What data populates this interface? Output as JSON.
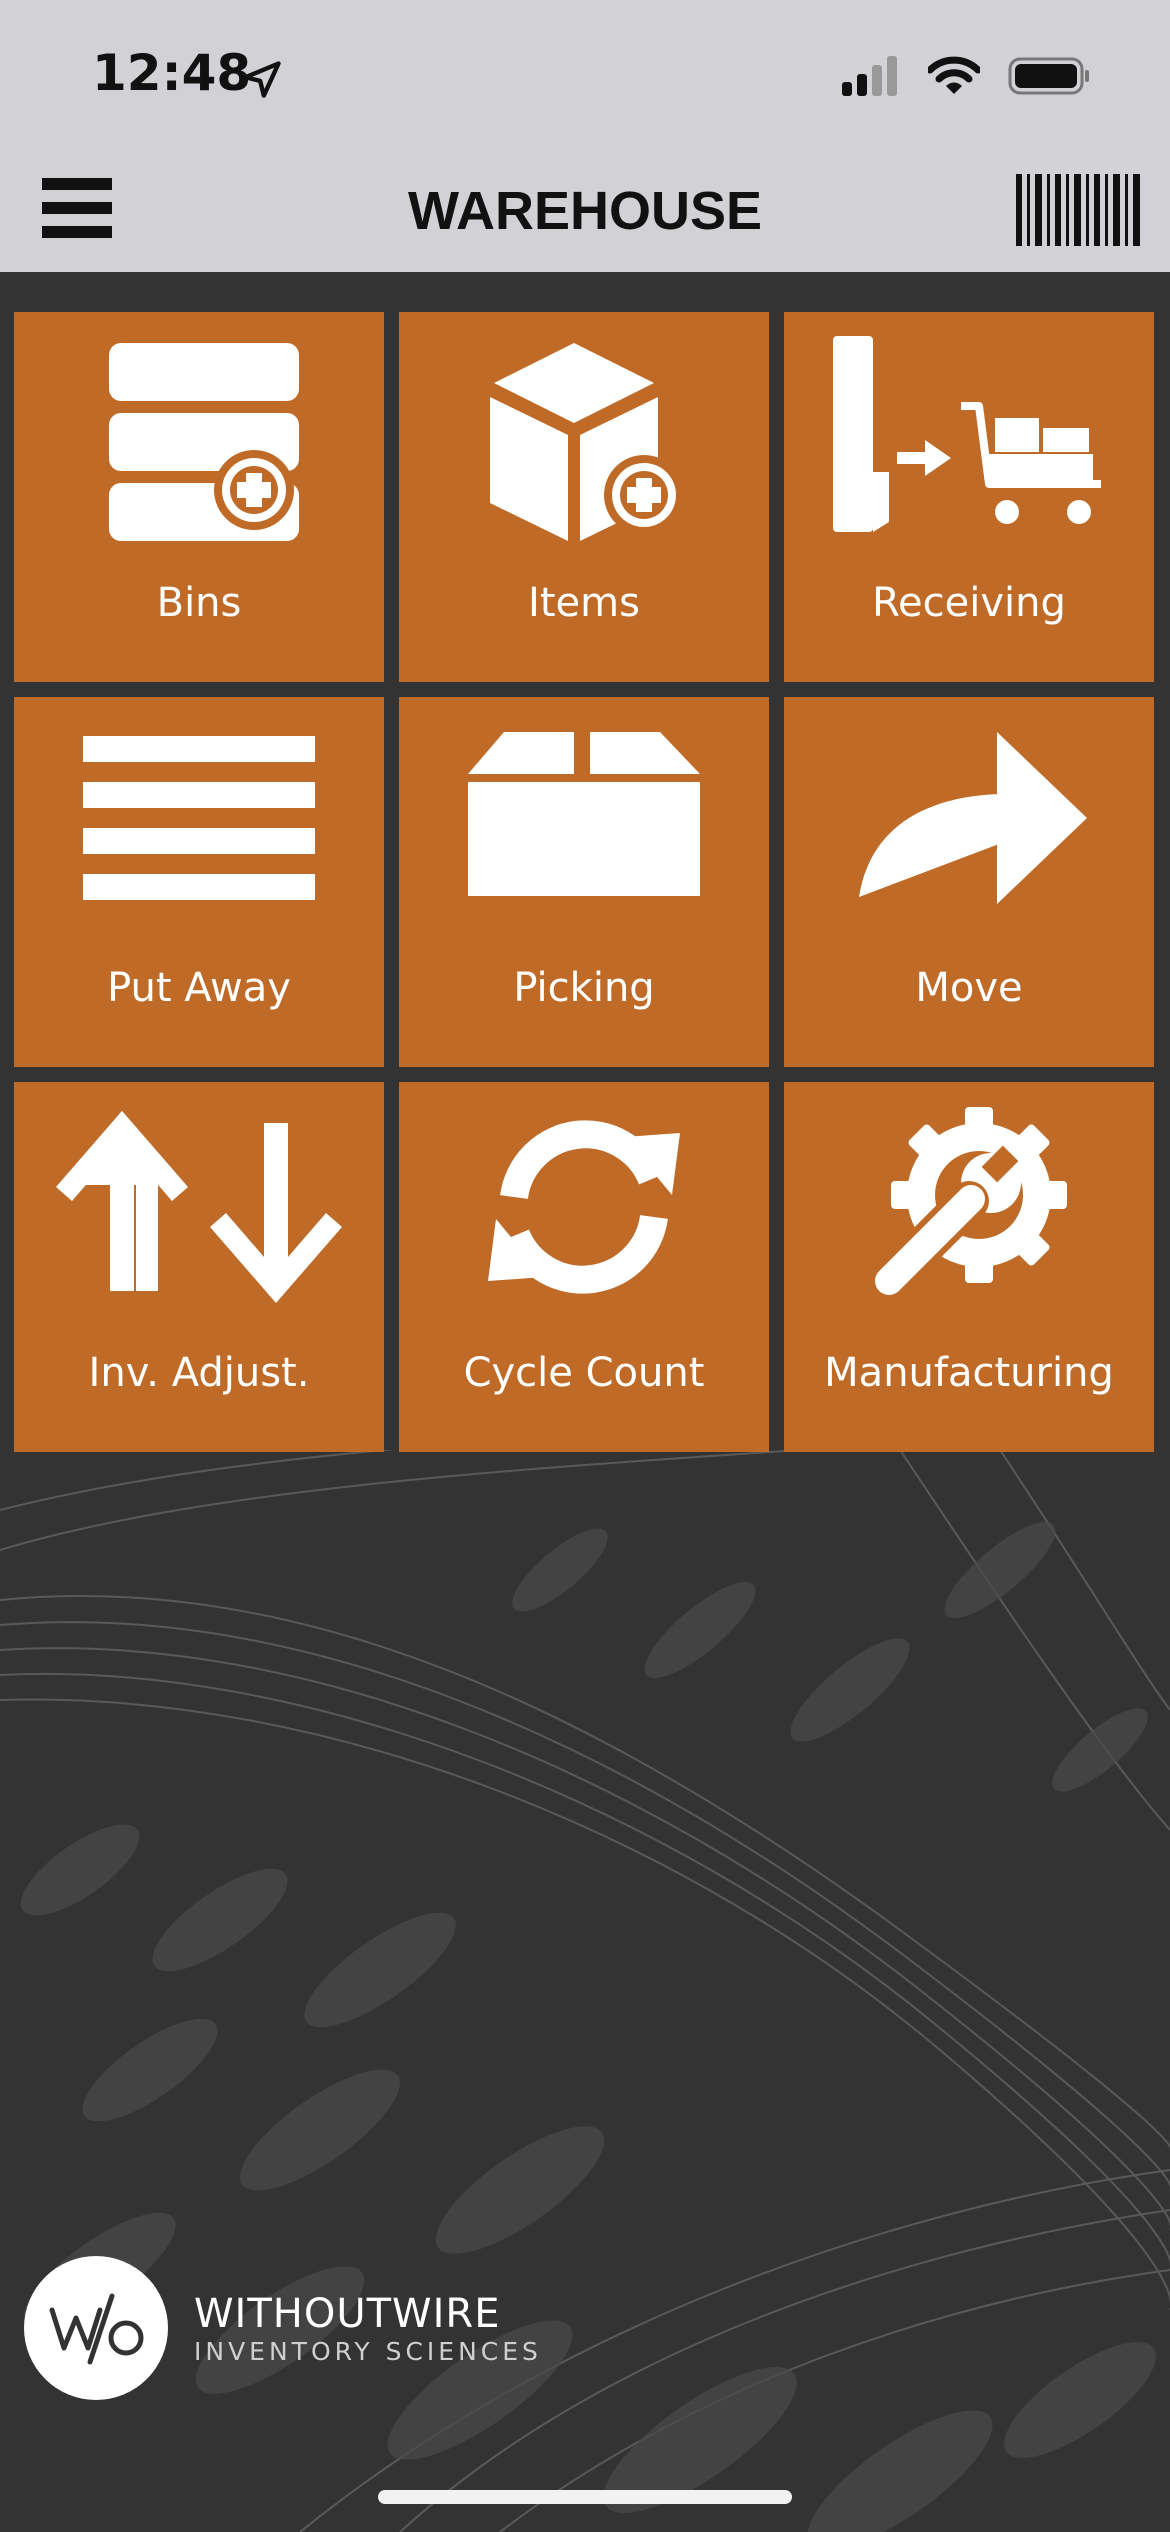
{
  "status_bar": {
    "time": "12:48",
    "icons": [
      "location-arrow-icon",
      "cellular-signal-icon",
      "wifi-icon",
      "battery-icon"
    ]
  },
  "nav": {
    "title": "WAREHOUSE",
    "menu_icon": "hamburger-menu-icon",
    "scan_icon": "barcode-icon"
  },
  "tiles": [
    {
      "label": "Bins",
      "icon": "bins-add-icon"
    },
    {
      "label": "Items",
      "icon": "box-add-icon"
    },
    {
      "label": "Receiving",
      "icon": "dock-cart-icon"
    },
    {
      "label": "Put Away",
      "icon": "list-lines-icon"
    },
    {
      "label": "Picking",
      "icon": "open-box-icon"
    },
    {
      "label": "Move",
      "icon": "curved-arrow-icon"
    },
    {
      "label": "Inv. Adjust.",
      "icon": "up-down-arrows-icon"
    },
    {
      "label": "Cycle Count",
      "icon": "refresh-cycle-icon"
    },
    {
      "label": "Manufacturing",
      "icon": "gear-wrench-icon"
    }
  ],
  "logo": {
    "mark": "W/O",
    "name": "WITHOUTWIRE",
    "subtitle": "INVENTORY SCIENCES"
  },
  "colors": {
    "tile": "#c06a27",
    "background": "#333333",
    "header": "#d2d2d6"
  }
}
